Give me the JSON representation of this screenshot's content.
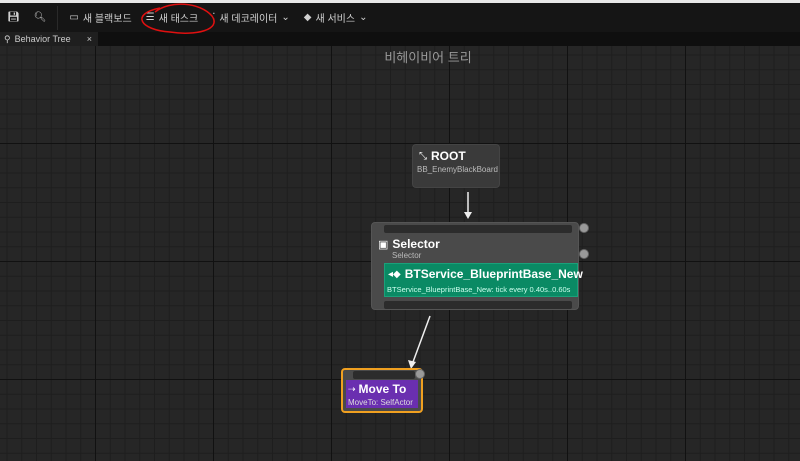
{
  "toolbar": {
    "items": [
      {
        "label": "새 블랙보드",
        "icon": "blackboard-icon"
      },
      {
        "label": "새 태스크",
        "icon": "task-icon"
      },
      {
        "label": "새 데코레이터",
        "icon": "decorator-icon"
      },
      {
        "label": "새 서비스",
        "icon": "service-icon"
      }
    ]
  },
  "tab": {
    "label": "Behavior Tree",
    "close": "×"
  },
  "graph": {
    "title": "비헤이비어 트리"
  },
  "nodes": {
    "root": {
      "title": "ROOT",
      "subtitle": "BB_EnemyBlackBoard"
    },
    "selector": {
      "title": "Selector",
      "subtitle": "Selector",
      "service": {
        "title": "BTService_BlueprintBase_New",
        "subtitle": "BTService_BlueprintBase_New: tick every 0.40s..0.60s"
      }
    },
    "moveto": {
      "title": "Move To",
      "subtitle": "MoveTo: SelfActor"
    }
  },
  "colors": {
    "service": "#0a8a64",
    "task": "#6a2fb0",
    "selected": "#f0a020",
    "annotation": "#e01010"
  }
}
